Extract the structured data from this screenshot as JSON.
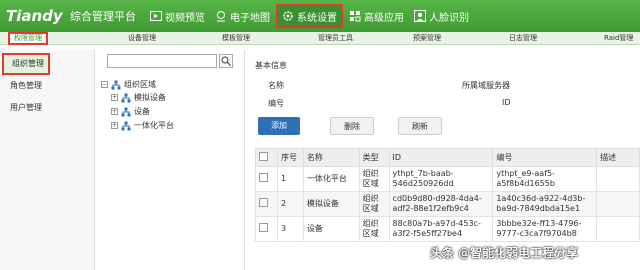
{
  "header": {
    "logo": "Tiandy",
    "app_title": "综合管理平台",
    "nav": [
      {
        "label": "视频预览"
      },
      {
        "label": "电子地图"
      },
      {
        "label": "系统设置"
      },
      {
        "label": "高级应用"
      },
      {
        "label": "人脸识别"
      }
    ]
  },
  "subnav": {
    "items": [
      "权限管理",
      "设备管理",
      "模板管理",
      "管理员工具",
      "预案管理",
      "日志管理",
      "Raid管理"
    ]
  },
  "sidebar": {
    "items": [
      "组织管理",
      "角色管理",
      "用户管理"
    ]
  },
  "tree": {
    "search_placeholder": "",
    "root": "组织区域",
    "children": [
      "模拟设备",
      "设备",
      "一体化平台"
    ]
  },
  "detail": {
    "section_title": "基本信息",
    "name_label": "名称",
    "server_label": "所属域服务器",
    "number_label": "编号",
    "id_label": "ID"
  },
  "actions": {
    "add": "添加",
    "delete": "删除",
    "refresh": "刷新"
  },
  "table": {
    "headers": [
      "序号",
      "名称",
      "类型",
      "ID",
      "编号",
      "描述"
    ],
    "rows": [
      {
        "index": "1",
        "name": "一体化平台",
        "type": "组织区域",
        "id": "ythpt_7b-baab-546d250926dd",
        "code": "ythpt_e9-aaf5-a5f8b4d1655b",
        "desc": ""
      },
      {
        "index": "2",
        "name": "模拟设备",
        "type": "组织区域",
        "id": "cd0b9d80-d928-4da4-adf2-88e1f2efb9c4",
        "code": "1a40c36d-a922-4d3b-ba9d-7849dbda15e1",
        "desc": ""
      },
      {
        "index": "3",
        "name": "设备",
        "type": "组织区域",
        "id": "88c80a7b-a97d-453c-a3f2-f5e5ff27be4",
        "code": "3bbbe32e-ff13-4796-9777-c3ca7f9704b8",
        "desc": ""
      }
    ]
  },
  "watermark": "头条 @智能化弱电工程分享"
}
